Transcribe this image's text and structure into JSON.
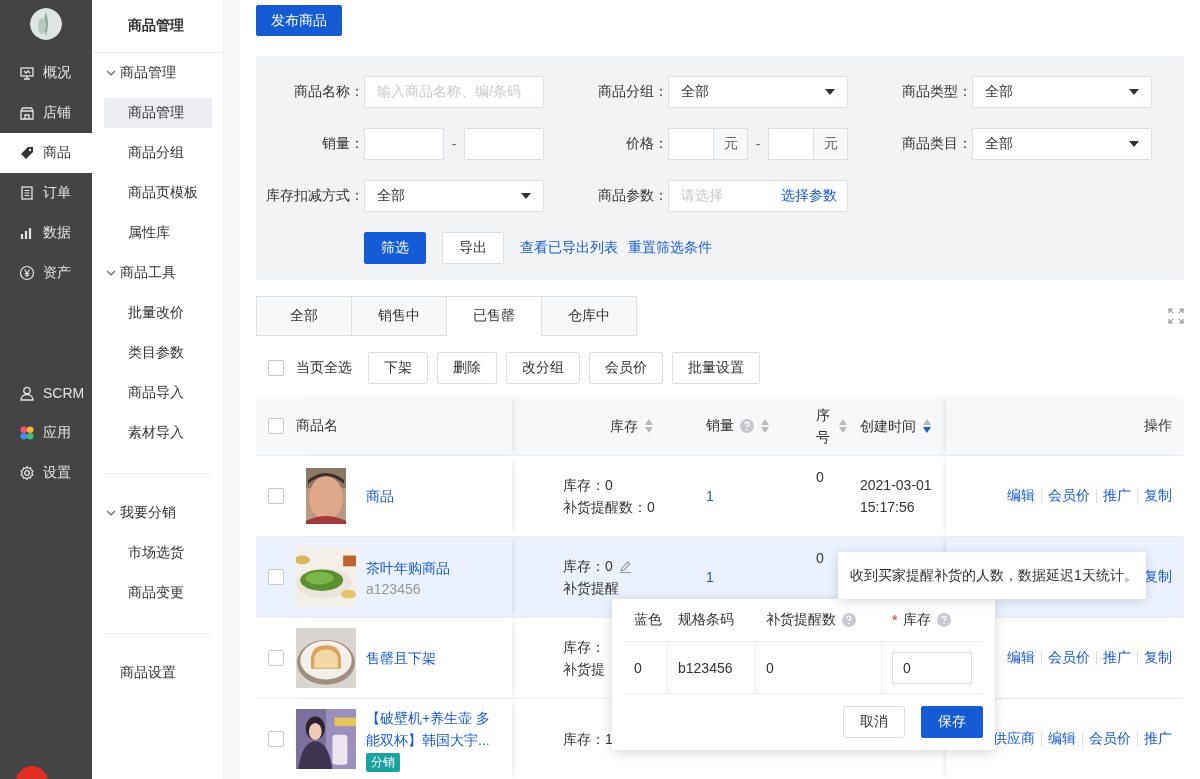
{
  "sidebar": {
    "nav_top": [
      {
        "label": "概况",
        "selected": false
      },
      {
        "label": "店铺",
        "selected": false
      },
      {
        "label": "商品",
        "selected": true
      },
      {
        "label": "订单",
        "selected": false
      },
      {
        "label": "数据",
        "selected": false
      },
      {
        "label": "资产",
        "selected": false
      }
    ],
    "nav_bottom": [
      {
        "label": "SCRM",
        "selected": false
      },
      {
        "label": "应用",
        "selected": false
      },
      {
        "label": "设置",
        "selected": false
      }
    ]
  },
  "submenu": {
    "title": "商品管理",
    "sections": [
      {
        "kind": "groups",
        "groups": [
          {
            "label": "商品管理",
            "expanded": true,
            "items": [
              {
                "label": "商品管理",
                "selected": true
              },
              {
                "label": "商品分组",
                "selected": false
              },
              {
                "label": "商品页模板",
                "selected": false
              },
              {
                "label": "属性库",
                "selected": false
              }
            ]
          },
          {
            "label": "商品工具",
            "expanded": true,
            "items": [
              {
                "label": "批量改价",
                "selected": false
              },
              {
                "label": "类目参数",
                "selected": false
              },
              {
                "label": "商品导入",
                "selected": false
              },
              {
                "label": "素材导入",
                "selected": false
              }
            ]
          }
        ]
      },
      {
        "kind": "groups",
        "groups": [
          {
            "label": "我要分销",
            "expanded": true,
            "items": [
              {
                "label": "市场选货",
                "selected": false
              },
              {
                "label": "商品变更",
                "selected": false
              }
            ]
          }
        ]
      },
      {
        "kind": "link",
        "label": "商品设置"
      }
    ]
  },
  "publish_button": "发布商品",
  "filters": {
    "fields": [
      {
        "kind": "text",
        "label": "商品名称：",
        "placeholder": "输入商品名称、编/条码"
      },
      {
        "kind": "select",
        "label": "商品分组：",
        "value": "全部"
      },
      {
        "kind": "select",
        "label": "商品类型：",
        "value": "全部"
      },
      {
        "kind": "range",
        "label": "销量：",
        "separator": "-"
      },
      {
        "kind": "price_range",
        "label": "价格：",
        "separator": "-",
        "units": [
          "元",
          "元"
        ]
      },
      {
        "kind": "select",
        "label": "商品类目：",
        "value": "全部"
      },
      {
        "kind": "select",
        "label": "库存扣减方式：",
        "value": "全部"
      },
      {
        "kind": "param",
        "label": "商品参数：",
        "placeholder": "请选择",
        "link": "选择参数"
      }
    ],
    "buttons": [
      {
        "label": "筛选",
        "primary": true
      },
      {
        "label": "导出",
        "primary": false
      }
    ],
    "links": [
      "查看已导出列表",
      "重置筛选条件"
    ]
  },
  "tabs": [
    {
      "label": "全部",
      "selected": false
    },
    {
      "label": "销售中",
      "selected": false
    },
    {
      "label": "已售罄",
      "selected": true
    },
    {
      "label": "仓库中",
      "selected": false
    }
  ],
  "bulk": {
    "checked": false,
    "label": "当页全选",
    "buttons": [
      "下架",
      "删除",
      "改分组",
      "会员价",
      "批量设置"
    ]
  },
  "table": {
    "select_all_checked": false,
    "columns": [
      {
        "label": "商品名"
      },
      {
        "label": "库存",
        "sorted": false
      },
      {
        "label": "销量",
        "help": true,
        "sorted": false
      },
      {
        "label": "序号",
        "sorted": false
      },
      {
        "label": "创建时间",
        "sorted": true
      },
      {
        "label": "操作"
      }
    ],
    "rows": [
      {
        "checked": false,
        "highlighted": false,
        "name": "商品",
        "stock": "库存：0",
        "reminders": "补货提醒数：0",
        "sales": "1",
        "seq": "0",
        "created": "2021-03-01 15:17:56",
        "actions": [
          "编辑",
          "会员价",
          "推广",
          "复制"
        ]
      },
      {
        "checked": false,
        "highlighted": true,
        "name": "茶叶年购商品",
        "code": "a123456",
        "stock": "库存：0",
        "reminders": "补货提醒",
        "sales": "1",
        "seq": "0",
        "actions": [
          "复制"
        ]
      },
      {
        "checked": false,
        "highlighted": false,
        "name": "售罄且下架",
        "stock": "库存：",
        "reminders": "补货提",
        "actions": [
          "编辑",
          "会员价",
          "推广",
          "复制"
        ]
      },
      {
        "checked": false,
        "highlighted": false,
        "name": "【破壁机+养生壶 多能双杯】韩国大宇...",
        "tag": "分销",
        "stock": "库存：1",
        "actions": [
          "供应商",
          "编辑",
          "会员价",
          "推广"
        ]
      }
    ]
  },
  "popover": {
    "columns": [
      {
        "label": "蓝色"
      },
      {
        "label": "规格条码"
      },
      {
        "label": "补货提醒数",
        "help": true
      },
      {
        "label": "库存",
        "required_mark": "*",
        "help": true
      }
    ],
    "cells": [
      "0",
      "b123456",
      "0"
    ],
    "stock_value": "0",
    "buttons": [
      {
        "label": "取消",
        "primary": false
      },
      {
        "label": "保存",
        "primary": true
      }
    ]
  },
  "tooltip": "收到买家提醒补货的人数，数据延迟1天统计。"
}
